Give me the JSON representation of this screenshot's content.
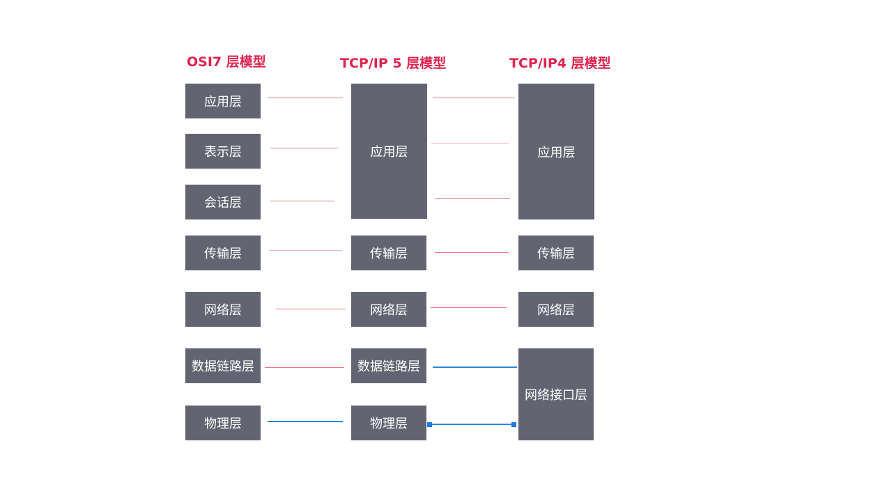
{
  "titles": {
    "osi": "OSI7 层模型",
    "tcp5": "TCP/IP 5 层模型",
    "tcp4": "TCP/IP4 层模型"
  },
  "osi_layers": [
    "应用层",
    "表示层",
    "会话层",
    "传输层",
    "网络层",
    "数据链路层",
    "物理层"
  ],
  "tcp5_layers": [
    "应用层",
    "传输层",
    "网络层",
    "数据链路层",
    "物理层"
  ],
  "tcp4_layers": [
    "应用层",
    "传输层",
    "网络层",
    "网络接口层"
  ],
  "colors": {
    "box": "#626472",
    "title": "#e0234e",
    "connector": "#e87583",
    "connector_selected": "#2f86d6"
  }
}
